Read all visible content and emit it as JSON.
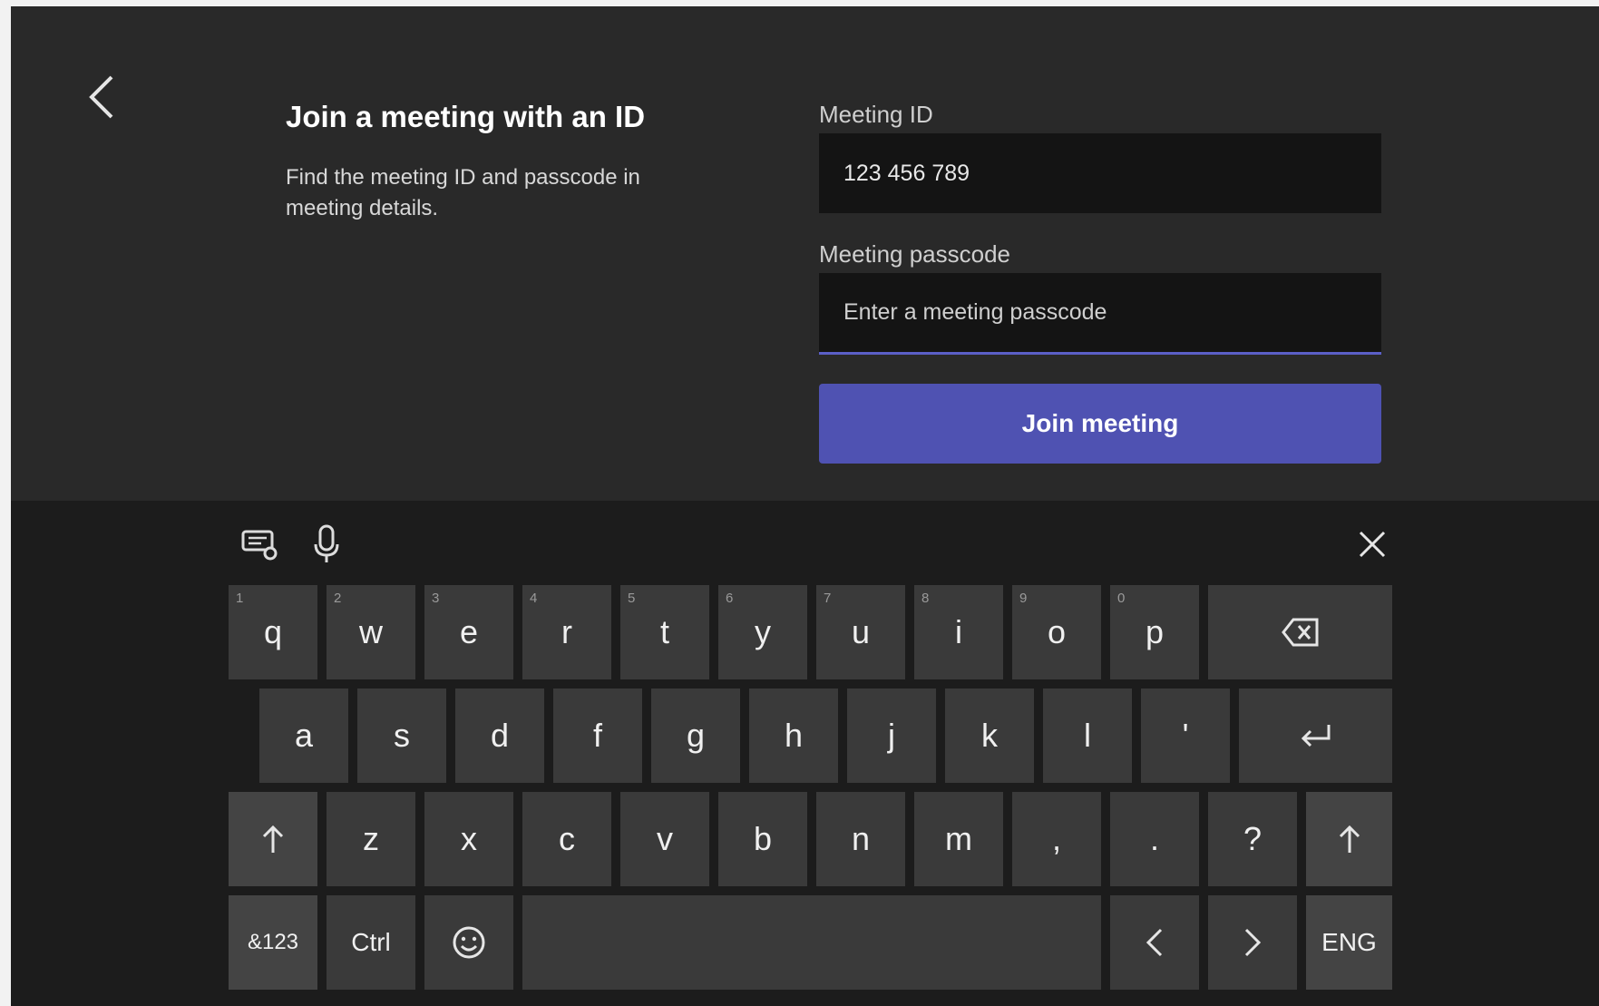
{
  "page": {
    "title": "Join a meeting with an ID",
    "description": "Find the meeting ID and passcode in meeting details."
  },
  "form": {
    "meeting_id_label": "Meeting ID",
    "meeting_id_value": "123 456 789",
    "passcode_label": "Meeting passcode",
    "passcode_placeholder": "Enter a meeting passcode",
    "passcode_value": "",
    "join_label": "Join meeting"
  },
  "colors": {
    "background": "#292929",
    "input": "#141414",
    "accent": "#4f52b2",
    "keyboard": "#1c1c1c",
    "key": "#3a3a3a"
  },
  "keyboard": {
    "toolbar": [
      "keyboard-settings-icon",
      "microphone-icon",
      "close-icon"
    ],
    "row1": [
      {
        "label": "q",
        "hint": "1"
      },
      {
        "label": "w",
        "hint": "2"
      },
      {
        "label": "e",
        "hint": "3"
      },
      {
        "label": "r",
        "hint": "4"
      },
      {
        "label": "t",
        "hint": "5"
      },
      {
        "label": "y",
        "hint": "6"
      },
      {
        "label": "u",
        "hint": "7"
      },
      {
        "label": "i",
        "hint": "8"
      },
      {
        "label": "o",
        "hint": "9"
      },
      {
        "label": "p",
        "hint": "0"
      }
    ],
    "backspace_icon": "backspace-icon",
    "row2": [
      "a",
      "s",
      "d",
      "f",
      "g",
      "h",
      "j",
      "k",
      "l",
      "'"
    ],
    "enter_icon": "enter-icon",
    "shift_icon": "shift-icon",
    "row3": [
      "z",
      "x",
      "c",
      "v",
      "b",
      "n",
      "m",
      ",",
      ".",
      "?"
    ],
    "symbols_label": "&123",
    "ctrl_label": "Ctrl",
    "emoji_icon": "emoji-icon",
    "left_icon": "chevron-left-icon",
    "right_icon": "chevron-right-icon",
    "language_label": "ENG"
  }
}
